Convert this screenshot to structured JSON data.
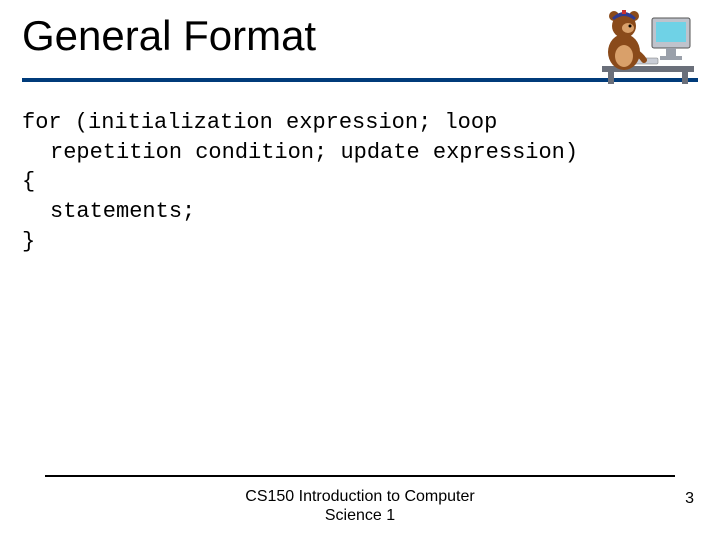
{
  "title": "General Format",
  "code": {
    "line1": "for (initialization expression; loop",
    "line2": "repetition condition; update expression)",
    "line3": "{",
    "line4": "statements;",
    "line5": "}"
  },
  "footer": {
    "course_line1": "CS150 Introduction to Computer",
    "course_line2": "Science 1",
    "page": "3"
  },
  "clipart": {
    "name": "bear-at-computer"
  },
  "colors": {
    "rule": "#003b7a"
  }
}
